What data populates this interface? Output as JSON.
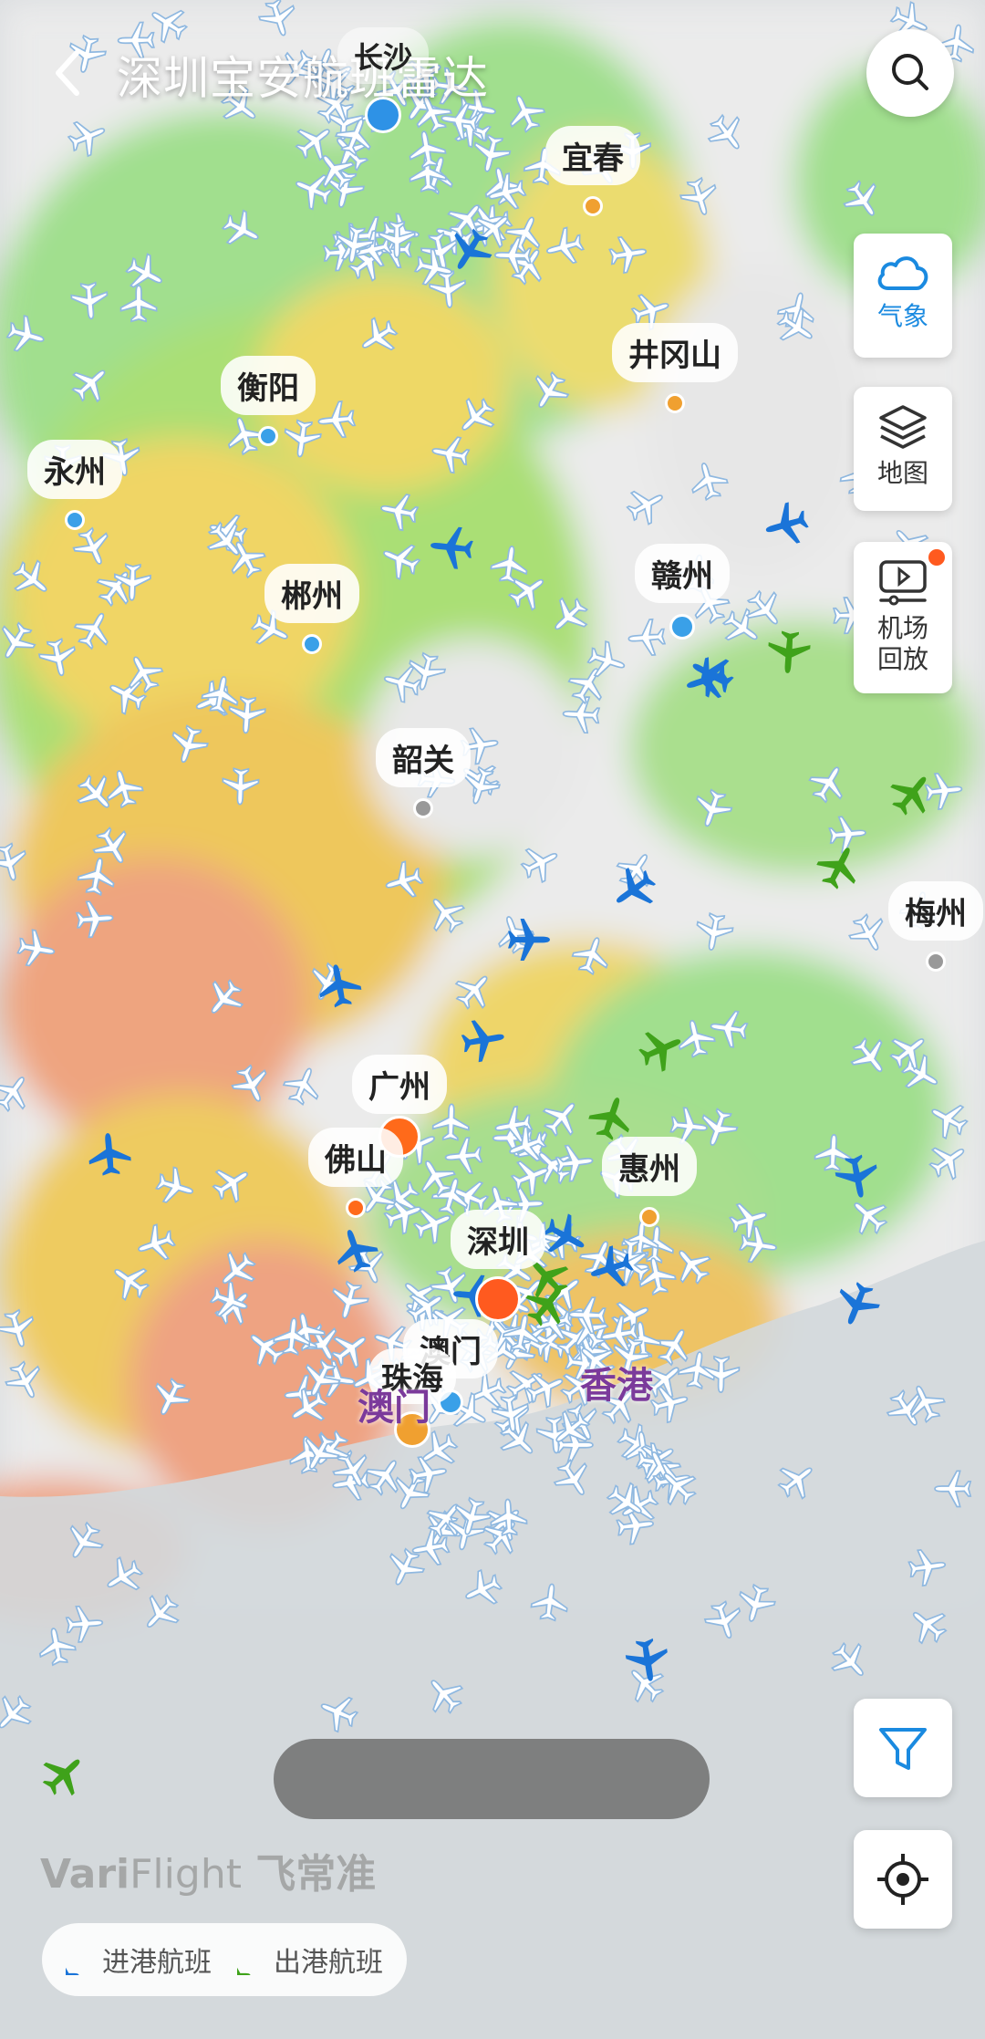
{
  "header": {
    "title": "深圳宝安航班雷达"
  },
  "side_buttons": {
    "weather": "气象",
    "map": "地图",
    "replay_line1": "机场",
    "replay_line2": "回放"
  },
  "cities": [
    {
      "key": "yichun",
      "name": "宜春",
      "dot": "#f0a030"
    },
    {
      "key": "jinggangshan",
      "name": "井冈山",
      "dot": "#f0a030"
    },
    {
      "key": "hengyang",
      "name": "衡阳",
      "dot": "#3aa0e8"
    },
    {
      "key": "yongzhou",
      "name": "永州",
      "dot": "#3aa0e8"
    },
    {
      "key": "chenzhou",
      "name": "郴州",
      "dot": "#3aa0e8"
    },
    {
      "key": "ganzhou",
      "name": "赣州",
      "dot": "#3aa0e8"
    },
    {
      "key": "shaoguan",
      "name": "韶关",
      "dot": "#999999"
    },
    {
      "key": "meizhou",
      "name": "梅州",
      "dot": "#999999"
    },
    {
      "key": "guangzhou",
      "name": "广州",
      "dot": "#ff6a1a"
    },
    {
      "key": "foshan",
      "name": "佛山",
      "dot": "#ff6a1a"
    },
    {
      "key": "huizhou",
      "name": "惠州",
      "dot": "#f0a030"
    },
    {
      "key": "shenzhen",
      "name": "深圳",
      "dot": "#ff5a1f"
    },
    {
      "key": "macau",
      "name": "澳门",
      "dot": "#3aa0e8"
    },
    {
      "key": "zhuhai",
      "name": "珠海",
      "dot": "#f0a030"
    }
  ],
  "top_city": "长沙",
  "map_labels": {
    "hongkong": "香港",
    "macau_region": "澳门"
  },
  "watermark": {
    "brand_bold": "Vari",
    "brand_light": "Flight",
    "cn": "飞常准"
  },
  "legend": {
    "arrival": "进港航班",
    "departure": "出港航班"
  },
  "colors": {
    "arrival": "#1a74d8",
    "departure": "#3fa21a",
    "accent": "#1a8ae0"
  }
}
